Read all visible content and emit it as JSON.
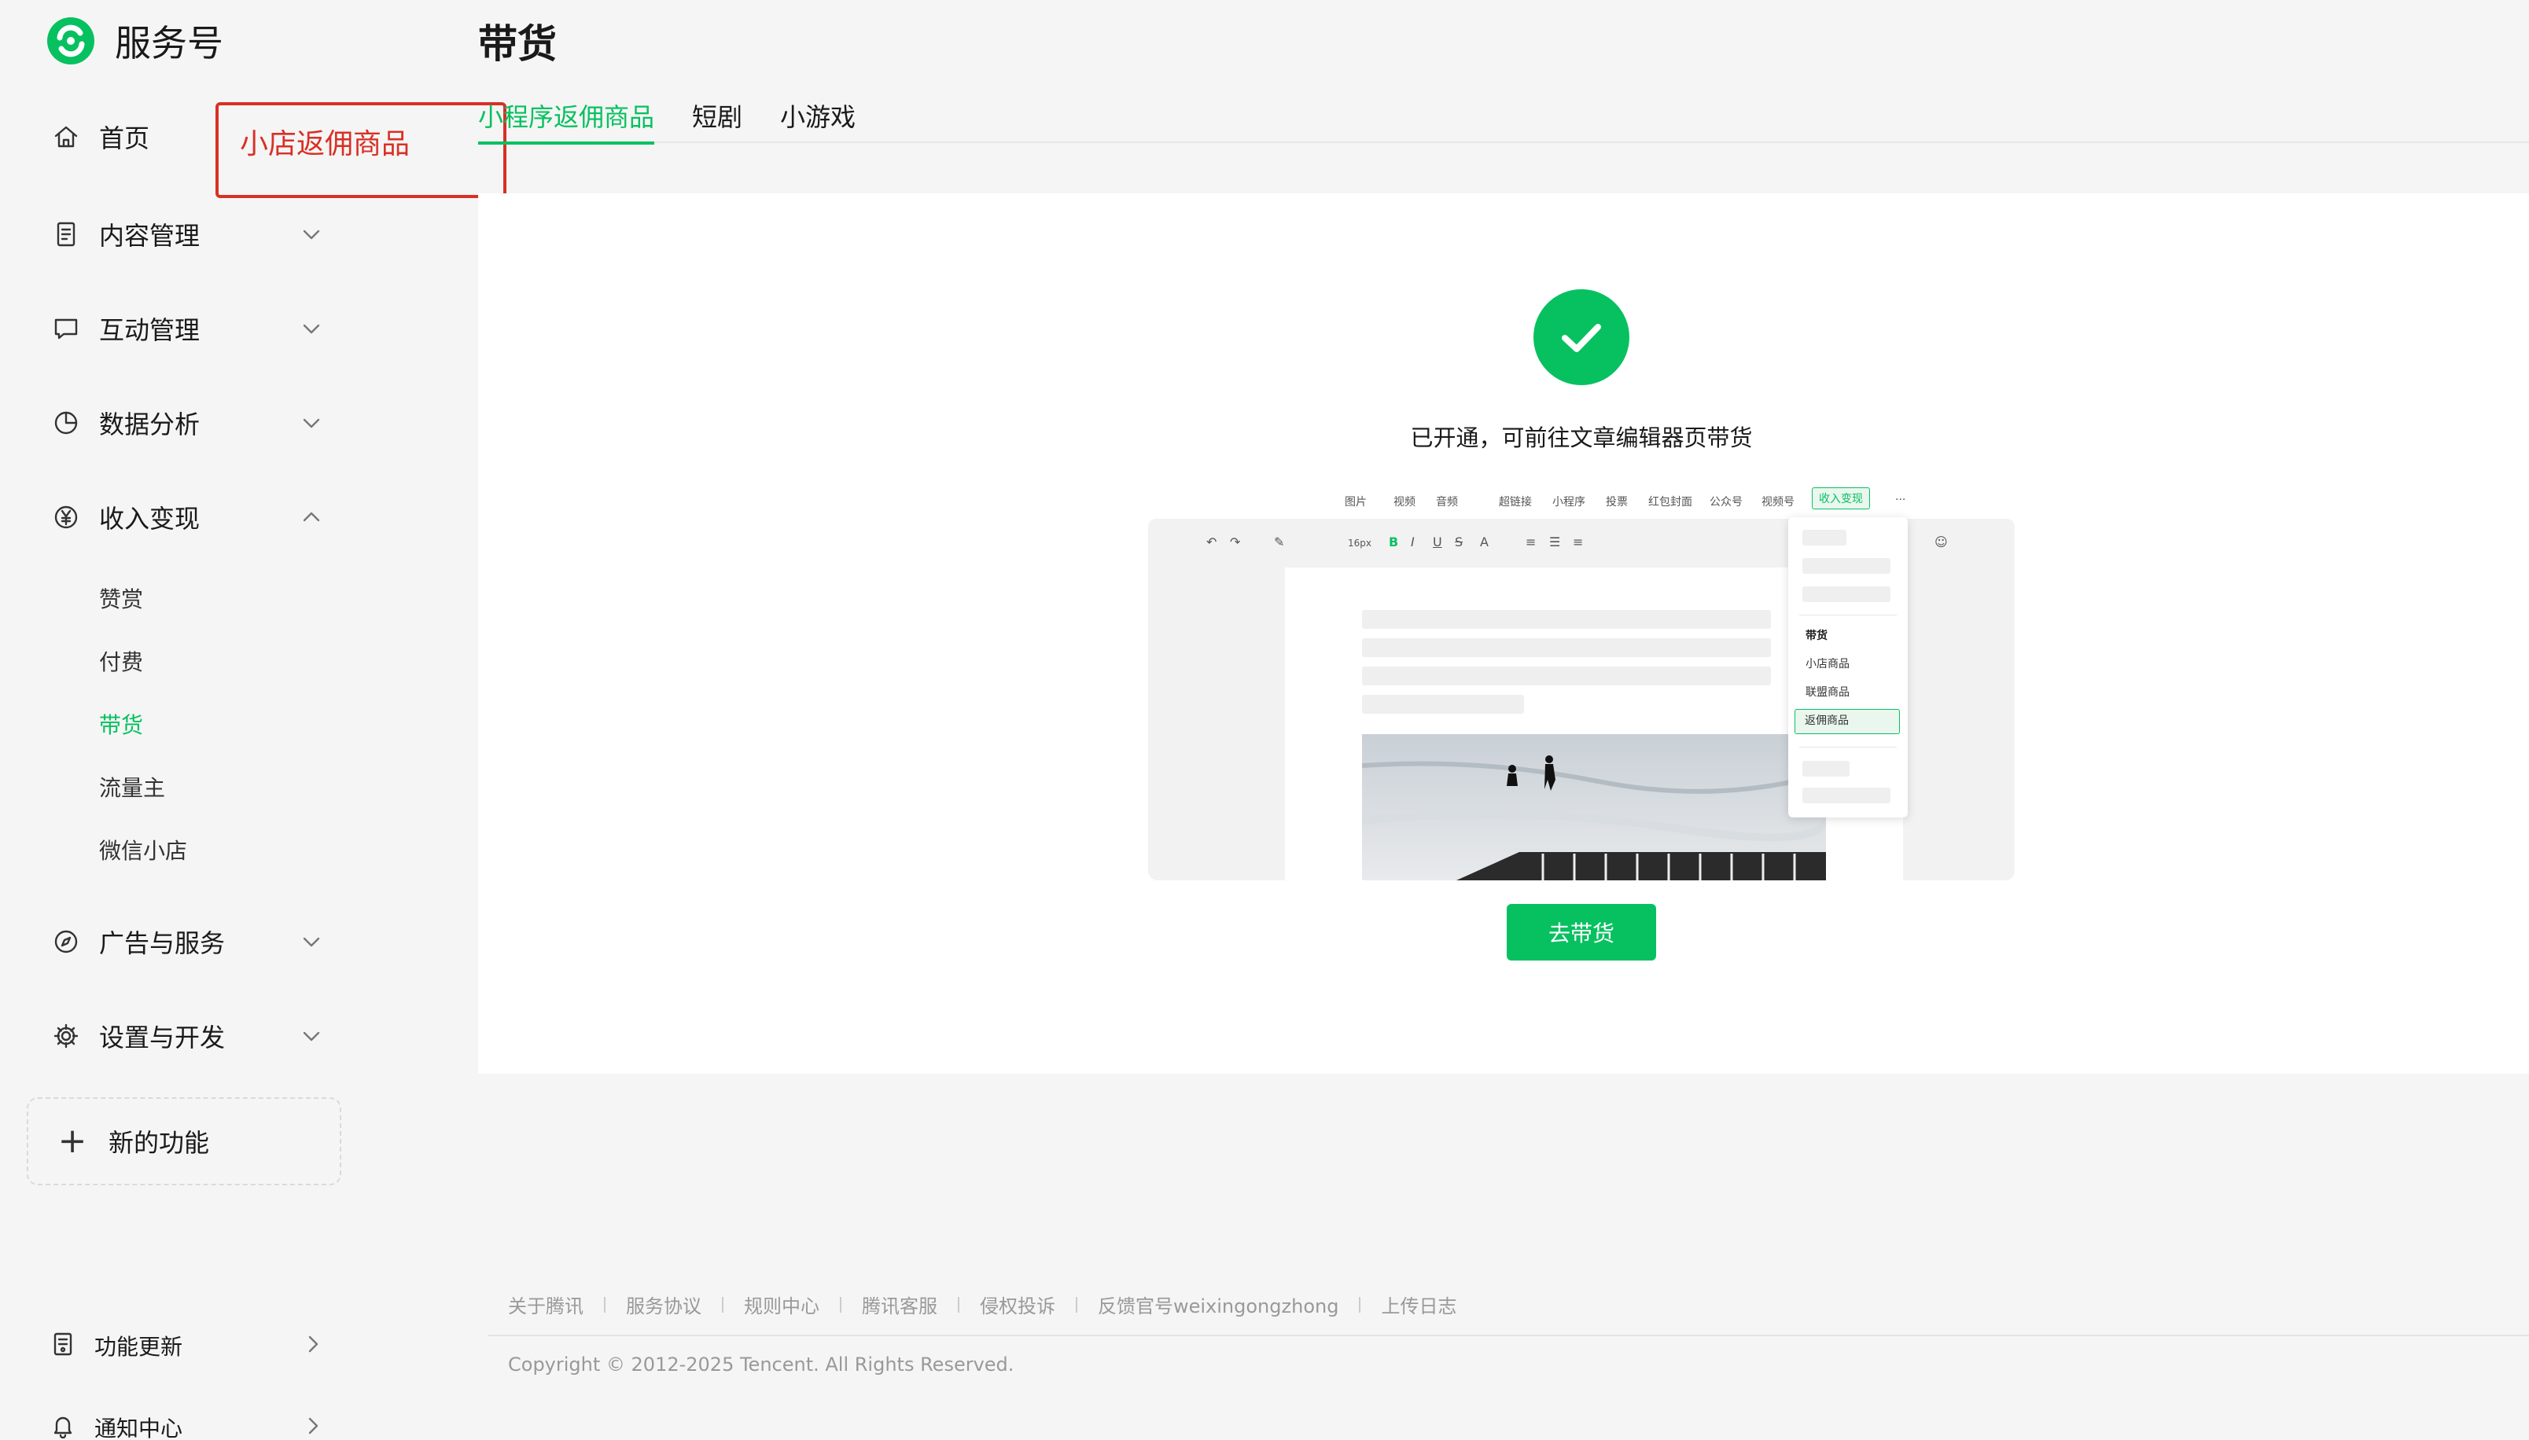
{
  "app": {
    "logo_text": "服务号",
    "brand_color": "#07c160"
  },
  "sidebar": {
    "items": [
      {
        "label": "首页",
        "icon": "home-icon"
      },
      {
        "label": "内容管理",
        "icon": "document-icon",
        "chevron": "down"
      },
      {
        "label": "互动管理",
        "icon": "chat-icon",
        "chevron": "down"
      },
      {
        "label": "数据分析",
        "icon": "pie-chart-icon",
        "chevron": "down"
      },
      {
        "label": "收入变现",
        "icon": "yuan-icon",
        "chevron": "up"
      },
      {
        "label": "广告与服务",
        "icon": "compass-icon",
        "chevron": "down"
      },
      {
        "label": "设置与开发",
        "icon": "gear-icon",
        "chevron": "down"
      }
    ],
    "sub_items": [
      "赞赏",
      "付费",
      "带货",
      "流量主",
      "微信小店"
    ],
    "active_sub_item": "带货",
    "new_feature": "新的功能",
    "bottom_items": [
      {
        "label": "功能更新",
        "icon": "update-icon"
      },
      {
        "label": "通知中心",
        "icon": "bell-icon"
      }
    ]
  },
  "annotation": {
    "text": "小店返佣商品",
    "color": "#d93025"
  },
  "main": {
    "title": "带货",
    "tabs": [
      "小程序返佣商品",
      "短剧",
      "小游戏"
    ],
    "active_tab": "小程序返佣商品",
    "status_text": "已开通，可前往文章编辑器页带货",
    "cta_label": "去带货"
  },
  "illustration": {
    "menu_tabs": [
      "图片",
      "视频",
      "音频",
      "超链接",
      "小程序",
      "投票",
      "红包封面",
      "公众号",
      "视频号",
      "收入变现"
    ],
    "toolbar_font_size": "16px",
    "dropdown_title": "带货",
    "dropdown_items": [
      "小店商品",
      "联盟商品",
      "返佣商品"
    ],
    "dropdown_selected": "返佣商品"
  },
  "footer": {
    "links": [
      "关于腾讯",
      "服务协议",
      "规则中心",
      "腾讯客服",
      "侵权投诉",
      "反馈官号weixingongzhong",
      "上传日志"
    ],
    "copyright": "Copyright © 2012-2025 Tencent. All Rights Reserved."
  }
}
